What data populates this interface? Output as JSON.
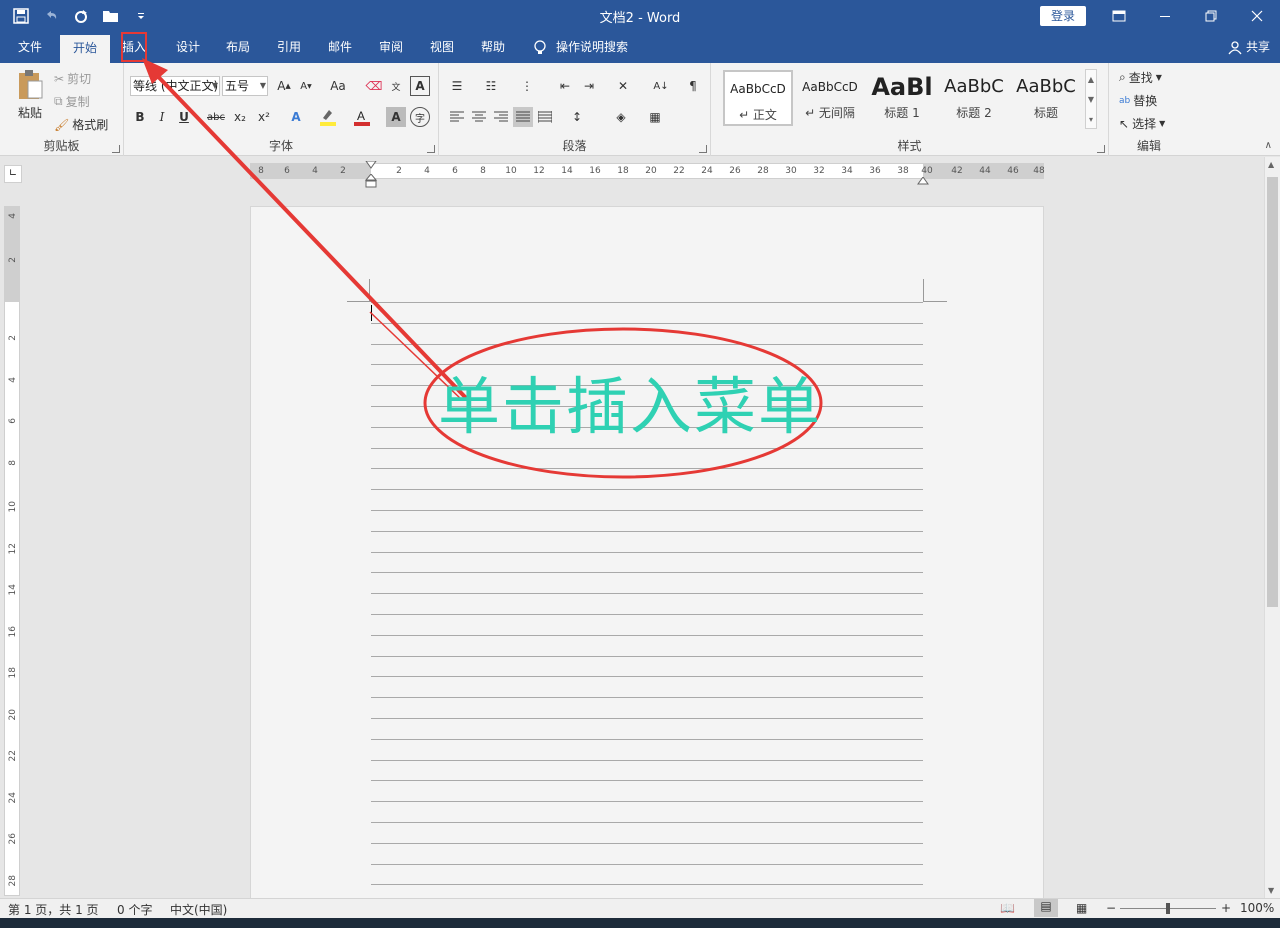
{
  "window": {
    "title": "文档2 - Word",
    "login_label": "登录",
    "share_label": "共享"
  },
  "tabs": [
    "文件",
    "开始",
    "插入",
    "设计",
    "布局",
    "引用",
    "邮件",
    "审阅",
    "视图",
    "帮助"
  ],
  "tell_me": "操作说明搜索",
  "clipboard": {
    "label": "剪贴板",
    "paste": "粘贴",
    "cut": "剪切",
    "copy": "复制",
    "format_painter": "格式刷"
  },
  "font": {
    "label": "字体",
    "font_name": "等线 (中文正文)",
    "font_size": "五号",
    "bold": "B",
    "italic": "I",
    "underline": "U",
    "strike": "abc",
    "subscript": "x₂",
    "superscript": "x²",
    "aa": "Aa"
  },
  "paragraph": {
    "label": "段落"
  },
  "styles": {
    "label": "样式",
    "items": [
      {
        "preview": "AaBbCcD",
        "name": "↵ 正文"
      },
      {
        "preview": "AaBbCcD",
        "name": "↵ 无间隔"
      },
      {
        "preview": "AaBl",
        "name": "标题 1"
      },
      {
        "preview": "AaBbC",
        "name": "标题 2"
      },
      {
        "preview": "AaBbC",
        "name": "标题"
      }
    ]
  },
  "editing": {
    "label": "编辑",
    "find": "查找",
    "replace": "替换",
    "select": "选择"
  },
  "ruler": {
    "h_ticks": [
      "8",
      "6",
      "4",
      "2",
      "2",
      "4",
      "6",
      "8",
      "10",
      "12",
      "14",
      "16",
      "18",
      "20",
      "22",
      "24",
      "26",
      "28",
      "30",
      "32",
      "34",
      "36",
      "38",
      "40",
      "42",
      "44",
      "46",
      "48"
    ],
    "v_ticks": [
      "4",
      "2",
      "2",
      "4",
      "6",
      "8",
      "10",
      "12",
      "14",
      "16",
      "18",
      "20",
      "22",
      "24",
      "26",
      "28"
    ]
  },
  "status": {
    "page": "第 1 页，共 1 页",
    "words": "0 个字",
    "language": "中文(中国)",
    "zoom": "100%",
    "zoom_level": 0.5
  },
  "annotation": {
    "text": "单击插入菜单",
    "color": "#2fd1b3",
    "ellipse_color": "#e53935",
    "arrow_color": "#e53935"
  },
  "colors": {
    "accent": "#2b579a",
    "highlight": "#ffeb3b",
    "font_color": "#d32f2f"
  }
}
